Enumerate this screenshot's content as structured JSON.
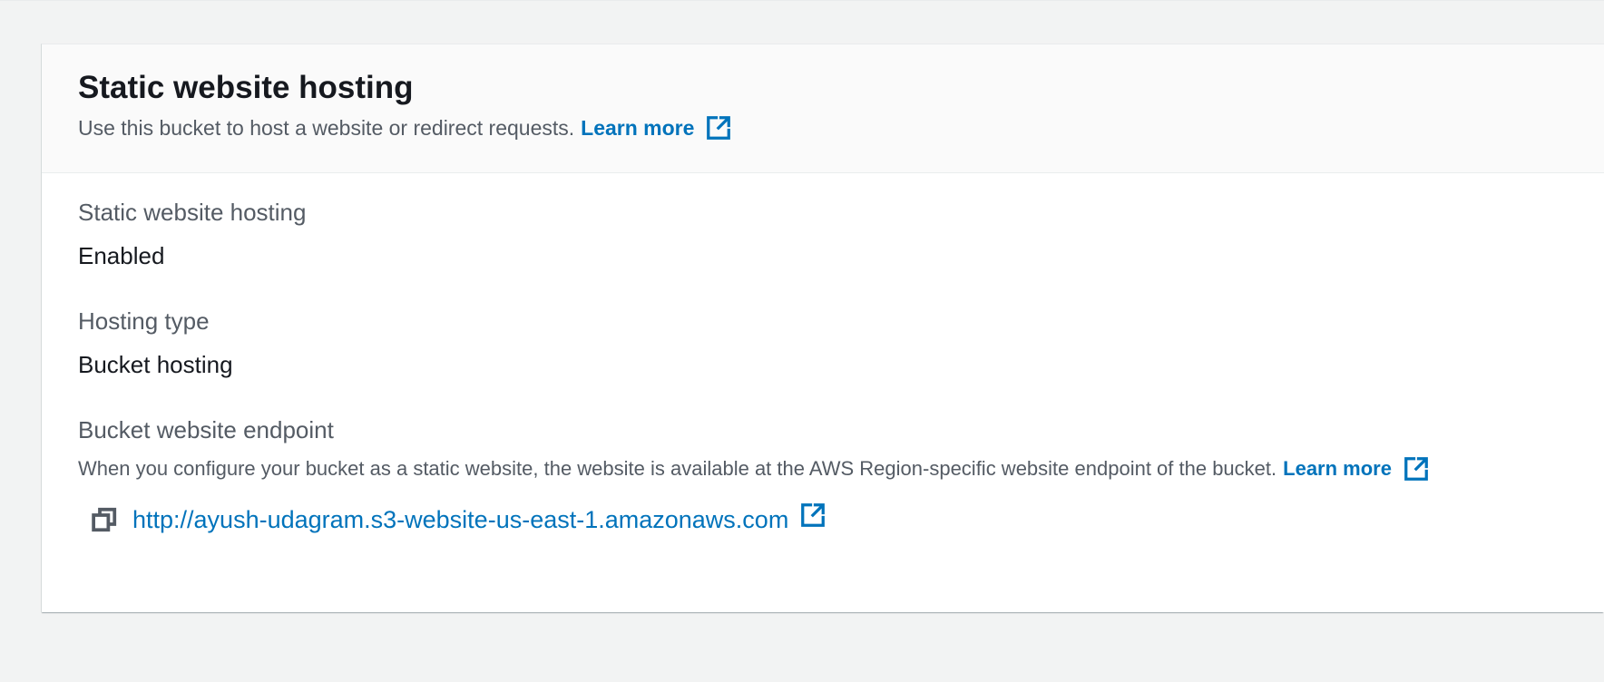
{
  "panel": {
    "title": "Static website hosting",
    "description": "Use this bucket to host a website or redirect requests.",
    "learn_more": "Learn more"
  },
  "fields": {
    "hosting": {
      "label": "Static website hosting",
      "value": "Enabled"
    },
    "hosting_type": {
      "label": "Hosting type",
      "value": "Bucket hosting"
    },
    "endpoint": {
      "label": "Bucket website endpoint",
      "description": "When you configure your bucket as a static website, the website is available at the AWS Region-specific website endpoint of the bucket.",
      "learn_more": "Learn more",
      "url": "http://ayush-udagram.s3-website-us-east-1.amazonaws.com"
    }
  },
  "icons": {
    "external_link": "external-link-icon",
    "copy": "copy-icon"
  },
  "colors": {
    "link": "#0073bb",
    "background": "#f2f3f3",
    "panel": "#ffffff",
    "header": "#fafafa",
    "secondary_text": "#545b64",
    "primary_text": "#16191f"
  }
}
